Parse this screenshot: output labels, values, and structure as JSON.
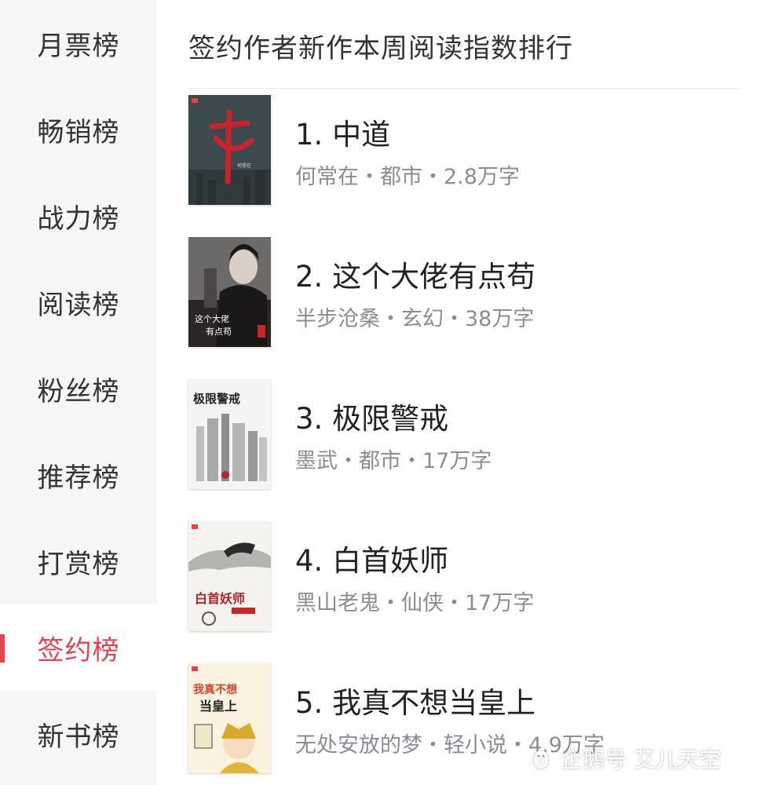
{
  "sidebar": {
    "items": [
      {
        "label": "月票榜"
      },
      {
        "label": "畅销榜"
      },
      {
        "label": "战力榜"
      },
      {
        "label": "阅读榜"
      },
      {
        "label": "粉丝榜"
      },
      {
        "label": "推荐榜"
      },
      {
        "label": "打赏榜"
      },
      {
        "label": "签约榜",
        "active": true
      },
      {
        "label": "新书榜"
      }
    ],
    "accent_color": "#e8424d"
  },
  "main": {
    "title": "签约作者新作本周阅读指数排行",
    "books": [
      {
        "title": "1. 中道",
        "meta": "何常在・都市・2.8万字",
        "cover_text": "中道"
      },
      {
        "title": "2. 这个大佬有点苟",
        "meta": "半步沧桑・玄幻・38万字",
        "cover_text": "这个大佬有点苟"
      },
      {
        "title": "3. 极限警戒",
        "meta": "墨武・都市・17万字",
        "cover_text": "极限警戒"
      },
      {
        "title": "4. 白首妖师",
        "meta": "黑山老鬼・仙侠・17万字",
        "cover_text": "白首妖师"
      },
      {
        "title": "5. 我真不想当皇上",
        "meta": "无处安放的梦・轻小说・4.9万字",
        "cover_text": "我真不想当皇上"
      }
    ]
  },
  "watermark": {
    "text": "企鹅号 艾儿天空",
    "icon": "penguin-icon"
  }
}
